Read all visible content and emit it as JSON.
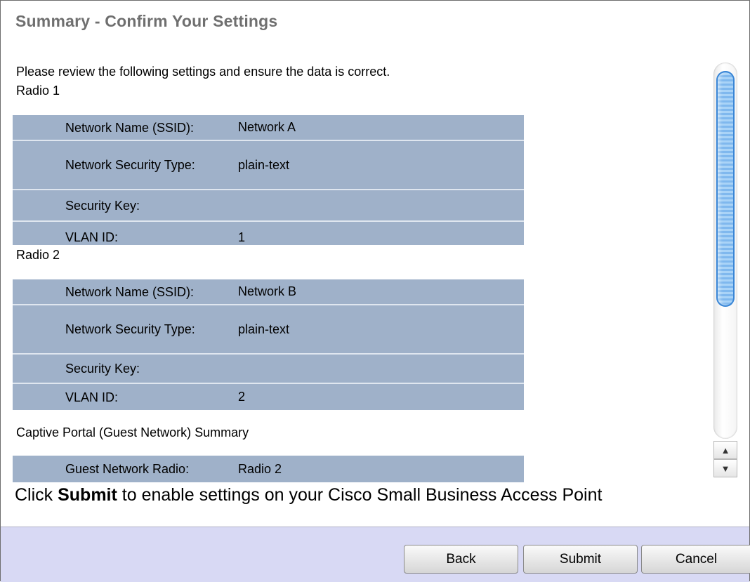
{
  "title": "Summary - Confirm Your Settings",
  "intro": "Please review the following settings and ensure the data is correct.",
  "radio1": {
    "label": "Radio 1",
    "rows": [
      {
        "label": "Network Name (SSID):",
        "value": "Network A"
      },
      {
        "label": "Network Security Type:",
        "value": "plain-text"
      },
      {
        "label": "Security Key:",
        "value": ""
      },
      {
        "label": "VLAN ID:",
        "value": "1"
      }
    ]
  },
  "radio2": {
    "label": "Radio 2",
    "rows": [
      {
        "label": "Network Name (SSID):",
        "value": "Network B"
      },
      {
        "label": "Network Security Type:",
        "value": "plain-text"
      },
      {
        "label": "Security Key:",
        "value": ""
      },
      {
        "label": "VLAN ID:",
        "value": "2"
      }
    ]
  },
  "captive": {
    "label": "Captive Portal (Guest Network) Summary",
    "rows": [
      {
        "label": "Guest Network Radio:",
        "value": "Radio 2"
      }
    ]
  },
  "instruction": {
    "prefix": "Click ",
    "bold": "Submit",
    "suffix": " to enable settings on your Cisco Small Business Access Point"
  },
  "buttons": {
    "back": "Back",
    "submit": "Submit",
    "cancel": "Cancel"
  },
  "scrollbar": {
    "up_glyph": "▲",
    "down_glyph": "▼"
  }
}
